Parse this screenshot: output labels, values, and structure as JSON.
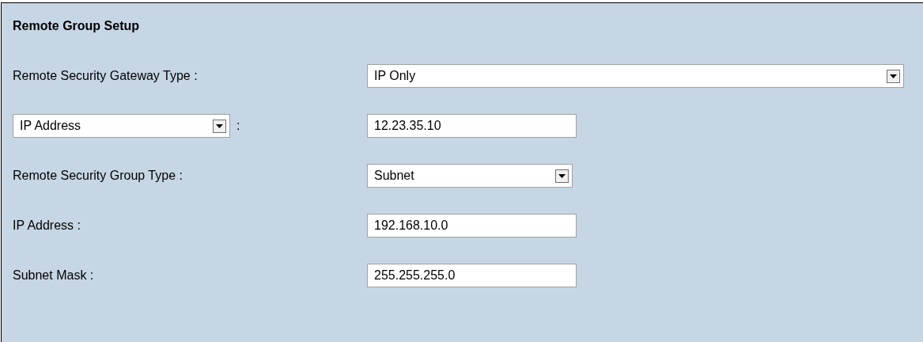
{
  "section": {
    "title": "Remote Group Setup"
  },
  "rows": [
    {
      "kind": "select",
      "label": "Remote Security Gateway Type :",
      "value": "IP Only",
      "wide": true
    },
    {
      "kind": "select-label-input",
      "label_select": "IP Address",
      "separator": ":",
      "value": "12.23.35.10"
    },
    {
      "kind": "select",
      "label": "Remote Security Group Type :",
      "value": "Subnet",
      "wide": false
    },
    {
      "kind": "input",
      "label": "IP Address :",
      "value": "192.168.10.0"
    },
    {
      "kind": "input",
      "label": "Subnet Mask :",
      "value": "255.255.255.0"
    }
  ]
}
